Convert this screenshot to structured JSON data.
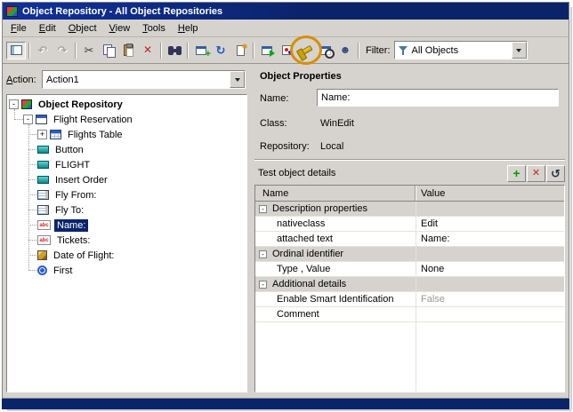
{
  "colors": {
    "titlebar": "#0a246a",
    "selection": "#0a246a",
    "annotation": "#d78f00"
  },
  "window": {
    "title": "Object Repository - All Object Repositories"
  },
  "menu": {
    "items": [
      "File",
      "Edit",
      "Object",
      "View",
      "Tools",
      "Help"
    ]
  },
  "toolbar": {
    "buttons": [
      {
        "name": "show-or-tree",
        "boxed": true
      },
      {
        "sep": true
      },
      {
        "name": "undo",
        "disabled": true
      },
      {
        "name": "redo",
        "disabled": true
      },
      {
        "sep": true
      },
      {
        "name": "cut"
      },
      {
        "name": "copy"
      },
      {
        "name": "paste"
      },
      {
        "name": "delete"
      },
      {
        "sep": true
      },
      {
        "name": "find"
      },
      {
        "sep": true
      },
      {
        "name": "add-objects"
      },
      {
        "name": "update-from-application"
      },
      {
        "name": "define-new-test-object"
      },
      {
        "sep": true
      },
      {
        "name": "navigate-learn"
      },
      {
        "name": "add-repository-parameter"
      },
      {
        "name": "highlight-in-application",
        "highlighted": true
      },
      {
        "name": "locate-in-repository"
      },
      {
        "name": "object-spy"
      },
      {
        "sep": true
      }
    ],
    "filter": {
      "label": "Filter:",
      "value": "All Objects"
    }
  },
  "action": {
    "label": "Action:",
    "value": "Action1"
  },
  "tree": {
    "items": [
      {
        "label": "Object Repository",
        "level": 0,
        "icon": "repository",
        "expander": "-",
        "bold": true
      },
      {
        "label": "Flight Reservation",
        "level": 1,
        "icon": "window",
        "expander": "-"
      },
      {
        "label": "Flights Table",
        "level": 2,
        "icon": "table",
        "expander": "+"
      },
      {
        "label": "Button",
        "level": 2,
        "icon": "button"
      },
      {
        "label": "FLIGHT",
        "level": 2,
        "icon": "button"
      },
      {
        "label": "Insert Order",
        "level": 2,
        "icon": "button"
      },
      {
        "label": "Fly From:",
        "level": 2,
        "icon": "list"
      },
      {
        "label": "Fly To:",
        "level": 2,
        "icon": "list"
      },
      {
        "label": "Name:",
        "level": 2,
        "icon": "edit",
        "selected": true
      },
      {
        "label": "Tickets:",
        "level": 2,
        "icon": "edit"
      },
      {
        "label": "Date of Flight:",
        "level": 2,
        "icon": "cube"
      },
      {
        "label": "First",
        "level": 2,
        "icon": "radio"
      }
    ]
  },
  "properties": {
    "header": "Object Properties",
    "name_label": "Name:",
    "name_value": "Name:",
    "class_label": "Class:",
    "class_value": "WinEdit",
    "repository_label": "Repository:",
    "repository_value": "Local",
    "details_header": "Test object details",
    "details_buttons": [
      {
        "name": "add-property",
        "kind": "add"
      },
      {
        "name": "delete-property",
        "kind": "del"
      },
      {
        "name": "restore-default",
        "kind": "restore"
      }
    ],
    "table": {
      "columns": [
        "Name",
        "Value"
      ],
      "rows": [
        {
          "name": "Description properties",
          "value": "",
          "group": true
        },
        {
          "name": "nativeclass",
          "value": "Edit"
        },
        {
          "name": "attached text",
          "value": "Name:"
        },
        {
          "name": "Ordinal identifier",
          "value": "",
          "group": true
        },
        {
          "name": "Type , Value",
          "value": "None"
        },
        {
          "name": "Additional details",
          "value": "",
          "group": true
        },
        {
          "name": "Enable Smart Identification",
          "value": "False",
          "muted": true
        },
        {
          "name": "Comment",
          "value": ""
        }
      ]
    }
  }
}
